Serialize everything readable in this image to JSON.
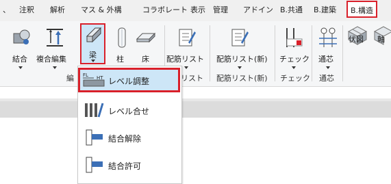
{
  "tabs": [
    "注釈",
    "解析",
    "マス & 外構",
    "コラボレート",
    "表示",
    "管理",
    "アドイン",
    "B.共通",
    "B.建築",
    "B.構造"
  ],
  "ribbon": {
    "tools": {
      "ketsugo": "結合",
      "fukugo_henshu": "複合編集",
      "hari": "梁",
      "hashira": "柱",
      "yuka": "床",
      "haikin_list": "配筋リスト",
      "haikin_list_new": "配筋リスト(新)",
      "check": "チェック",
      "tsushin": "通芯",
      "fuku_zu": "伏図",
      "jiku": "軸"
    },
    "panels": {
      "edit_partial": "編",
      "haikin_partial": "筋リスト",
      "haikin_new": "配筋リスト(新)",
      "check": "チェック",
      "tsushin": "通芯"
    }
  },
  "menu": {
    "items": [
      "レベル調整",
      "レベル合せ",
      "結合解除",
      "結合許可"
    ],
    "icon_text": {
      "fl": "FL",
      "ht": "HT"
    }
  },
  "colors": {
    "accent_red": "#d9202a",
    "selected_bg": "#cde6f7",
    "icon_blue": "#3b6fb6"
  }
}
